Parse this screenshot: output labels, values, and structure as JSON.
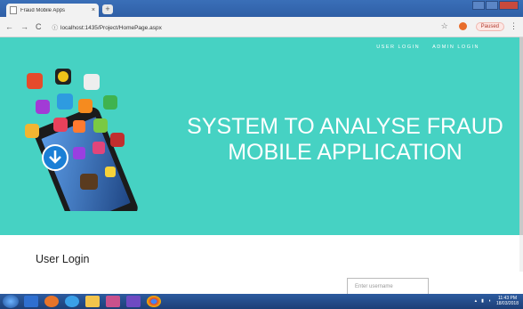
{
  "browser": {
    "tab_title": "Fraud Mobile Apps",
    "tab_close": "×",
    "new_tab": "+",
    "url": "localhost:1435/Project/HomePage.aspx",
    "profile_status": "Paused",
    "nav_icons": [
      "back-arrow-icon",
      "forward-arrow-icon",
      "reload-icon",
      "info-icon"
    ]
  },
  "nav": {
    "user_login": "USER LOGIN",
    "admin_login": "ADMIN LOGIN"
  },
  "hero": {
    "title_line1": "SYSTEM TO ANALYSE FRAUD",
    "title_line2": "MOBILE APPLICATION",
    "background_color": "#46d2c3"
  },
  "login": {
    "title": "User Login",
    "username_placeholder": "Enter username"
  },
  "taskbar": {
    "apps": [
      "start-icon",
      "media-player-icon",
      "firefox-icon",
      "internet-explorer-icon",
      "file-explorer-icon",
      "app-icon",
      "visual-studio-icon",
      "chrome-icon"
    ],
    "time": "11:43 PM",
    "date": "18/03/2018"
  }
}
